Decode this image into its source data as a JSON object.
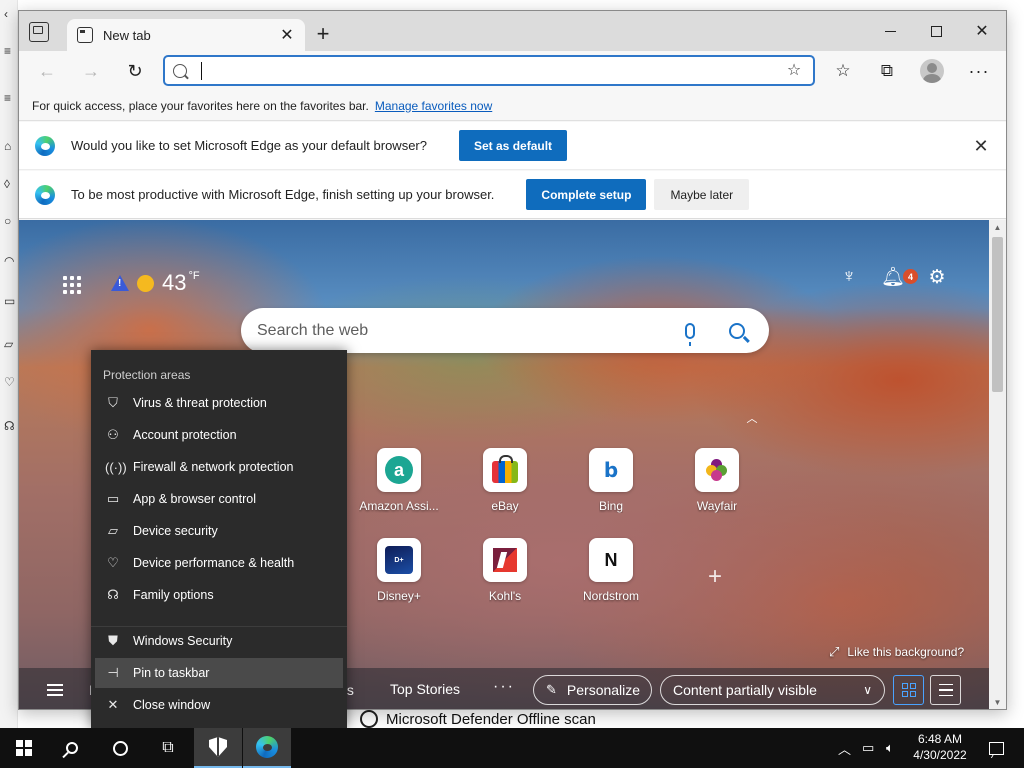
{
  "browser": {
    "tab": {
      "label": "New tab"
    },
    "address": {
      "value": "",
      "placeholder": ""
    },
    "favbar": {
      "text": "For quick access, place your favorites here on the favorites bar.",
      "link": "Manage favorites now"
    },
    "infobar_default": {
      "text": "Would you like to set Microsoft Edge as your default browser?",
      "button": "Set as default"
    },
    "infobar_setup": {
      "text": "To be most productive with Microsoft Edge, finish setting up your browser.",
      "primary": "Complete setup",
      "secondary": "Maybe later"
    }
  },
  "ntp": {
    "weather": {
      "temp": "43",
      "unit": "°F"
    },
    "notification_count": "4",
    "search": {
      "placeholder": "Search the web"
    },
    "tiles": [
      {
        "label": "Amazon Assi..."
      },
      {
        "label": "eBay"
      },
      {
        "label": "Bing"
      },
      {
        "label": "Wayfair"
      },
      {
        "label": "Disney+"
      },
      {
        "label": "Kohl's"
      },
      {
        "label": "Nordstrom"
      }
    ],
    "like_background": "Like this background?",
    "nav": {
      "partial_left": "I",
      "partial_right": "ts",
      "top_stories": "Top Stories",
      "more": "···",
      "personalize": "Personalize",
      "content_visibility": "Content partially visible"
    }
  },
  "jumplist": {
    "header": "Protection areas",
    "items": [
      {
        "label": "Virus & threat protection",
        "icon": "shield-outline-icon"
      },
      {
        "label": "Account protection",
        "icon": "person-icon"
      },
      {
        "label": "Firewall & network protection",
        "icon": "wifi-icon"
      },
      {
        "label": "App & browser control",
        "icon": "app-window-icon"
      },
      {
        "label": "Device security",
        "icon": "laptop-icon"
      },
      {
        "label": "Device performance & health",
        "icon": "heart-icon"
      },
      {
        "label": "Family options",
        "icon": "family-icon"
      }
    ],
    "app": "Windows Security",
    "pin": "Pin to taskbar",
    "close": "Close window"
  },
  "background": {
    "defender_item": "Microsoft Defender Offline scan"
  },
  "taskbar": {
    "time": "6:48 AM",
    "date": "4/30/2022"
  }
}
